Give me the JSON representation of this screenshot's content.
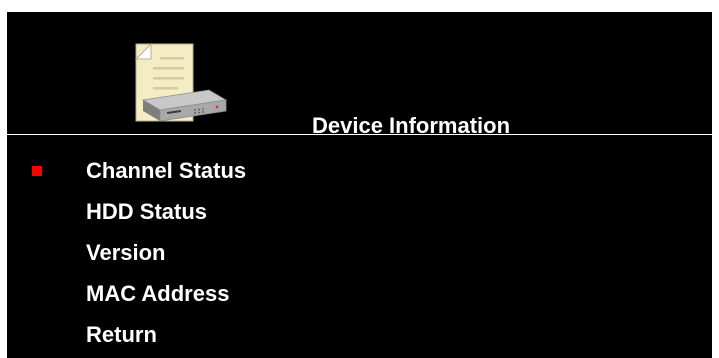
{
  "header": {
    "title": "Device Information",
    "icon": "device-info-icon"
  },
  "menu": {
    "selected_index": 0,
    "items": [
      {
        "label": "Channel Status"
      },
      {
        "label": "HDD Status"
      },
      {
        "label": "Version"
      },
      {
        "label": "MAC Address"
      },
      {
        "label": "Return"
      }
    ]
  },
  "colors": {
    "background": "#000000",
    "text": "#ffffff",
    "cursor": "#ff0000"
  }
}
